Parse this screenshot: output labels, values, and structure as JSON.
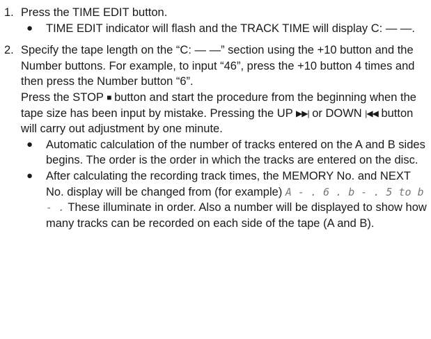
{
  "steps": [
    {
      "number": "1.",
      "text": "Press the TIME EDIT button.",
      "bullets": [
        "TIME EDIT indicator will flash and the TRACK TIME will display C: — —."
      ]
    },
    {
      "number": "2.",
      "text": "Specify the tape length on the “C: — —” section using the +10 button and the Number buttons. For example, to input “46”, press the +10 button 4 times and then press the Number button “6”.",
      "para2": {
        "a": "Press the STOP",
        "stop_glyph": "■",
        "b": "button and start the procedure from the beginning when the tape size has been input by mistake. Pressing the UP",
        "up_glyph": "▶▶|",
        "c": "or DOWN",
        "down_glyph": "|◀◀",
        "d": "button will carry out adjustment by one minute."
      },
      "bullets": [
        "Automatic calculation of the number of tracks entered on the A and B sides begins. The order is the order in which the tracks are entered on the disc."
      ],
      "bullet_last": {
        "a": "After calculating the recording track times, the MEMORY No. and NEXT No. display will be changed from (for example)",
        "seg": "A - . 6 . b - .  5 to b - .",
        "b": "These illuminate in order. Also a number will be displayed to show how many tracks can be recorded on each side of the tape (A and B)."
      }
    }
  ],
  "bullet_symbol": "●"
}
